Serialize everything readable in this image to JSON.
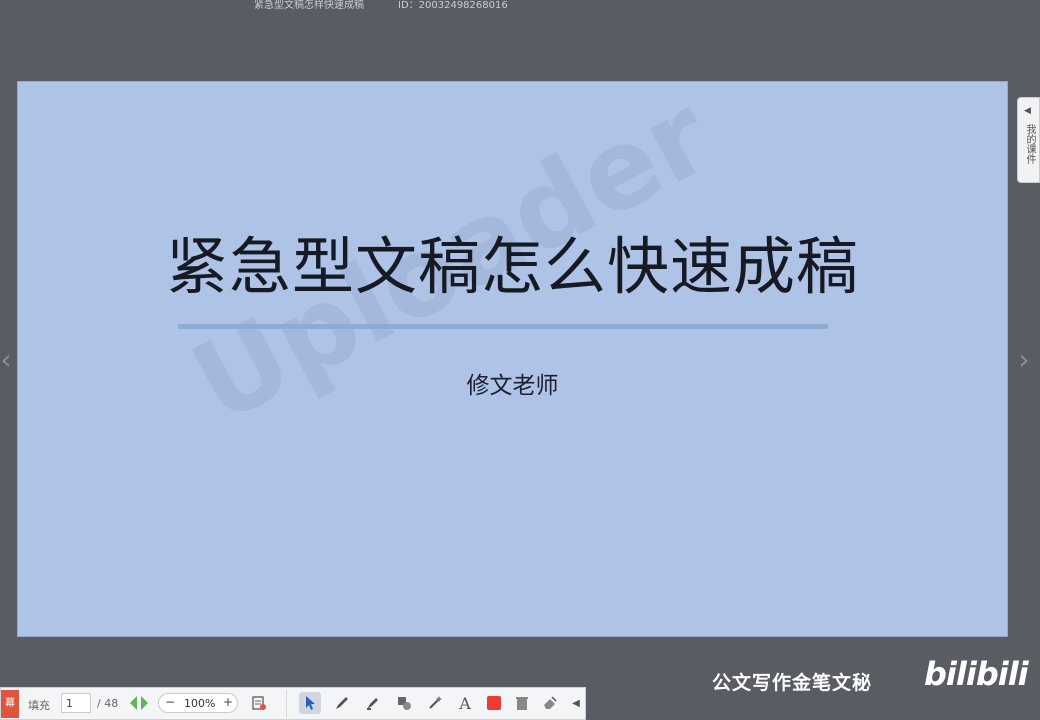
{
  "header": {
    "doc_title": "紧急型文稿怎样快速成稿",
    "doc_id": "ID：20032498268016"
  },
  "slide": {
    "title": "紧急型文稿怎么快速成稿",
    "subtitle": "修文老师",
    "watermark": "Uploader"
  },
  "side_tab": {
    "label": "我的课件"
  },
  "toolbar": {
    "red_label": "幕",
    "fill_label": "填充",
    "page_current": "1",
    "page_total": "/ 48",
    "zoom_value": "100%",
    "zoom_minus": "−",
    "zoom_plus": "+",
    "tools": [
      "select-pointer",
      "pen",
      "highlighter",
      "shape",
      "magic-wand",
      "text",
      "color",
      "delete",
      "eraser"
    ]
  },
  "branding": {
    "channel_name": "公文写作金笔文秘",
    "logo_text": "bilibili"
  },
  "colors": {
    "background": "#5a5c63",
    "slide_bg": "#afc3e6",
    "accent_red": "#ee3b33",
    "rule": "#8faad3"
  }
}
